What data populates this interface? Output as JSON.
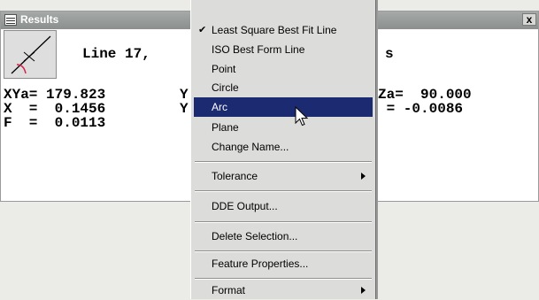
{
  "window": {
    "title": "Results",
    "close_label": "x",
    "icon": "results-grid-icon",
    "feature_icon": "line-feature-icon",
    "header_text_left": "Line 17,",
    "header_text_right": "s",
    "rows_left": [
      "XYa= 179.823",
      "X  =  0.1456",
      "F  =  0.0113"
    ],
    "rows_mid": [
      "Y",
      "Y"
    ],
    "rows_right": [
      "Za=  90.000",
      " = -0.0086"
    ]
  },
  "menu": {
    "items": [
      {
        "label": "Least Square Best Fit Line",
        "checked": true
      },
      {
        "label": "ISO Best Form Line"
      },
      {
        "label": "Point"
      },
      {
        "label": "Circle"
      },
      {
        "label": "Arc",
        "highlighted": true
      },
      {
        "label": "Plane"
      },
      {
        "label": "Change Name..."
      },
      {
        "label": "Tolerance",
        "submenu": true
      },
      {
        "label": "DDE Output..."
      },
      {
        "label": "Delete Selection..."
      },
      {
        "label": "Feature Properties..."
      },
      {
        "label": "Format",
        "submenu": true
      }
    ],
    "highlight_color": "#1c2a72"
  }
}
